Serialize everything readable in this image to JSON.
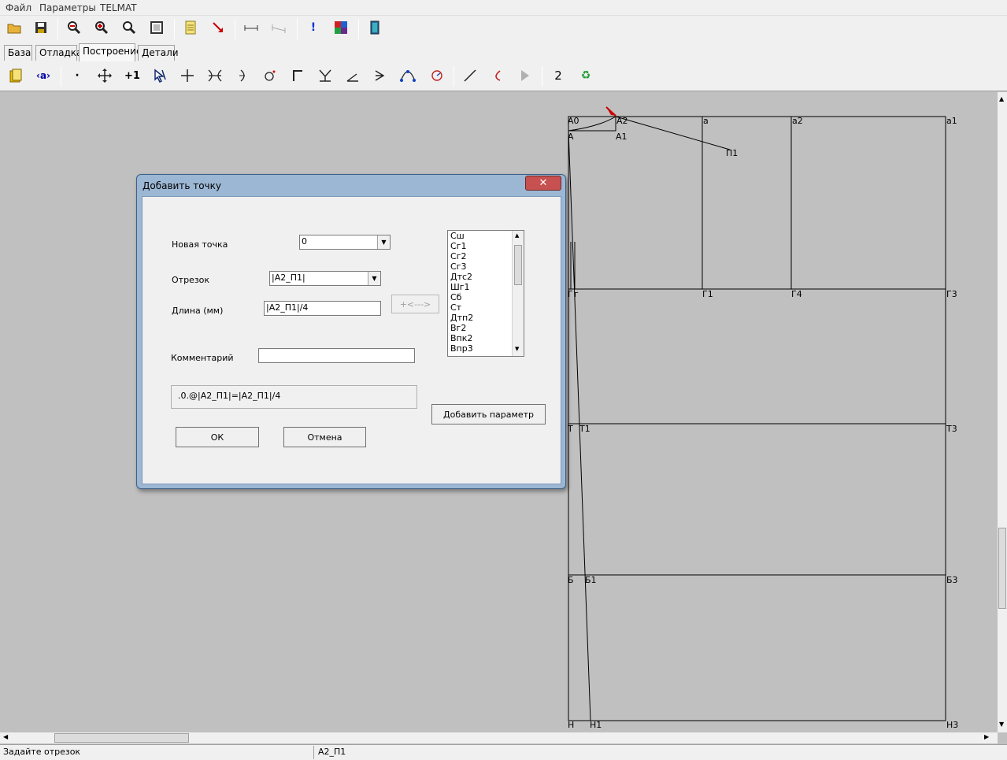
{
  "menubar": {
    "items": [
      "Файл",
      "Параметры",
      "TELMAT"
    ]
  },
  "toolbar1": {
    "icons": [
      "open-folder-icon",
      "save-icon",
      "zoom-out-icon",
      "zoom-in-icon",
      "zoom-icon",
      "zoom-fit-icon",
      "document-icon",
      "arrow-red-icon",
      "measure-icon",
      "measure-disabled-icon",
      "alert-icon",
      "palette-icon",
      "exit-door-icon"
    ]
  },
  "tabs": [
    {
      "label": "База",
      "active": false
    },
    {
      "label": "Отладка",
      "active": false
    },
    {
      "label": "Построение",
      "active": true
    },
    {
      "label": "Детали",
      "active": false
    }
  ],
  "toolbar2": {
    "page_number": "2"
  },
  "canvas": {
    "points": [
      "А0",
      "А2",
      "а",
      "а2",
      "а1",
      "А",
      "А1",
      "П1",
      "Г",
      "г",
      "Г1",
      "Г4",
      "Г3",
      "Т",
      "Т1",
      "Т3",
      "Б",
      "Б1",
      "Б3",
      "Н",
      "Н1",
      "Н3"
    ]
  },
  "statusbar": {
    "left": "Задайте отрезок",
    "right": "А2_П1"
  },
  "dialog": {
    "title": "Добавить точку",
    "new_point_label": "Новая точка",
    "new_point_value": "0",
    "segment_label": "Отрезок",
    "segment_value": "|А2_П1|",
    "length_label": "Длина (мм)",
    "length_value": "|А2_П1|/4",
    "arrow_button": "+<--->",
    "comment_label": "Комментарий",
    "comment_value": "",
    "formula": ".0.@|А2_П1|=|А2_П1|/4",
    "ok": "ОК",
    "cancel": "Отмена",
    "add_param": "Добавить параметр",
    "param_list": [
      "Сш",
      "Сг1",
      "Сг2",
      "Сг3",
      "Дтс2",
      "Шг1",
      "Сб",
      "Ст",
      "Дтп2",
      "Вг2",
      "Впк2",
      "Впр3"
    ]
  }
}
